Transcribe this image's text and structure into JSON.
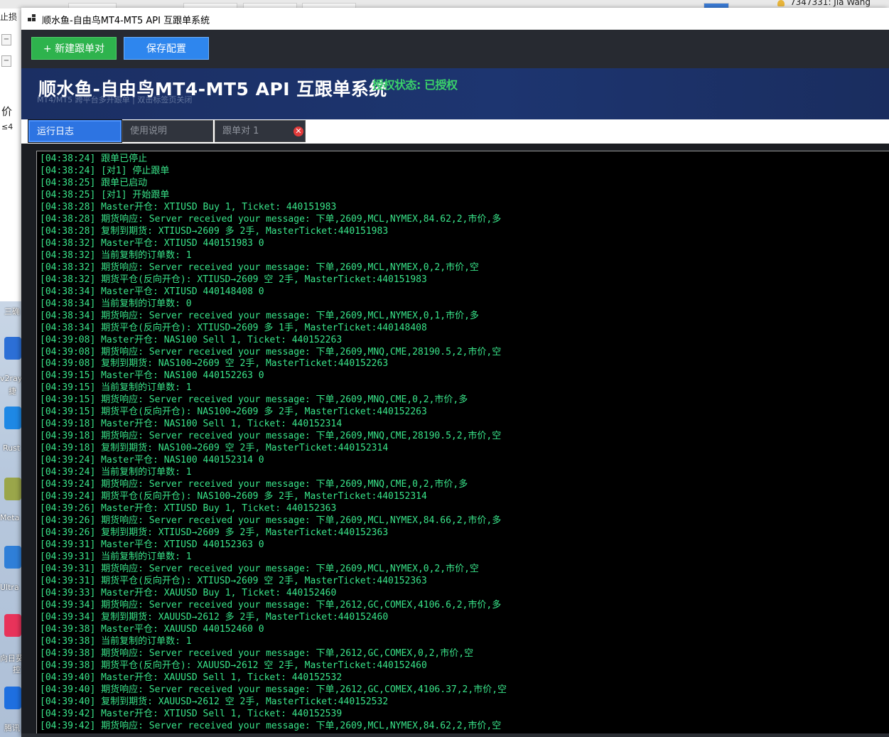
{
  "background": {
    "fragments": [
      "止损",
      "价",
      "≤4",
      "三确",
      "v2ray",
      "捷",
      "Rust",
      "Meta",
      "Ultra",
      "向日葵",
      "控",
      "腾讯"
    ],
    "user_label": "7347331: Jia Wang"
  },
  "window": {
    "title": "顺水鱼-自由鸟MT4-MT5 API 互跟单系统",
    "icon": "app-grid-icon"
  },
  "toolbar": {
    "new_pair_label": "+ 新建跟单对",
    "save_label": "保存配置",
    "new_color": "#2eb34d",
    "save_color": "#2e86ee"
  },
  "banner": {
    "title": "顺水鱼-自由鸟MT4-MT5 API 互跟单系统",
    "subtitle": "MT4/MT5 跨平台多开跟单 | 双击标签页关闭",
    "license_status": "授权状态: 已授权",
    "status_color": "#3ad06a"
  },
  "tabs": [
    {
      "label": "运行日志",
      "active": true
    },
    {
      "label": "使用说明",
      "active": false
    },
    {
      "label": "跟单对 1",
      "active": false,
      "closable": true
    }
  ],
  "log": {
    "text_color": "#39e58a",
    "lines": [
      "[04:38:24] 跟单已停止",
      "[04:38:24] [对1] 停止跟单",
      "[04:38:25] 跟单已启动",
      "[04:38:25] [对1] 开始跟单",
      "[04:38:28] Master开仓: XTIUSD Buy 1, Ticket: 440151983",
      "[04:38:28] 期货响应: Server received your message: 下单,2609,MCL,NYMEX,84.62,2,市价,多",
      "[04:38:28] 复制到期货: XTIUSD→2609 多 2手, MasterTicket:440151983",
      "[04:38:32] Master平仓: XTIUSD 440151983 0",
      "[04:38:32] 当前复制的订单数: 1",
      "[04:38:32] 期货响应: Server received your message: 下单,2609,MCL,NYMEX,0,2,市价,空",
      "[04:38:32] 期货平仓(反向开仓): XTIUSD→2609 空 2手, MasterTicket:440151983",
      "[04:38:34] Master平仓: XTIUSD 440148408 0",
      "[04:38:34] 当前复制的订单数: 0",
      "[04:38:34] 期货响应: Server received your message: 下单,2609,MCL,NYMEX,0,1,市价,多",
      "[04:38:34] 期货平仓(反向开仓): XTIUSD→2609 多 1手, MasterTicket:440148408",
      "[04:39:08] Master开仓: NAS100 Sell 1, Ticket: 440152263",
      "[04:39:08] 期货响应: Server received your message: 下单,2609,MNQ,CME,28190.5,2,市价,空",
      "[04:39:08] 复制到期货: NAS100→2609 空 2手, MasterTicket:440152263",
      "[04:39:15] Master平仓: NAS100 440152263 0",
      "[04:39:15] 当前复制的订单数: 1",
      "[04:39:15] 期货响应: Server received your message: 下单,2609,MNQ,CME,0,2,市价,多",
      "[04:39:15] 期货平仓(反向开仓): NAS100→2609 多 2手, MasterTicket:440152263",
      "[04:39:18] Master开仓: NAS100 Sell 1, Ticket: 440152314",
      "[04:39:18] 期货响应: Server received your message: 下单,2609,MNQ,CME,28190.5,2,市价,空",
      "[04:39:18] 复制到期货: NAS100→2609 空 2手, MasterTicket:440152314",
      "[04:39:24] Master平仓: NAS100 440152314 0",
      "[04:39:24] 当前复制的订单数: 1",
      "[04:39:24] 期货响应: Server received your message: 下单,2609,MNQ,CME,0,2,市价,多",
      "[04:39:24] 期货平仓(反向开仓): NAS100→2609 多 2手, MasterTicket:440152314",
      "[04:39:26] Master开仓: XTIUSD Buy 1, Ticket: 440152363",
      "[04:39:26] 期货响应: Server received your message: 下单,2609,MCL,NYMEX,84.66,2,市价,多",
      "[04:39:26] 复制到期货: XTIUSD→2609 多 2手, MasterTicket:440152363",
      "[04:39:31] Master平仓: XTIUSD 440152363 0",
      "[04:39:31] 当前复制的订单数: 1",
      "[04:39:31] 期货响应: Server received your message: 下单,2609,MCL,NYMEX,0,2,市价,空",
      "[04:39:31] 期货平仓(反向开仓): XTIUSD→2609 空 2手, MasterTicket:440152363",
      "[04:39:33] Master开仓: XAUUSD Buy 1, Ticket: 440152460",
      "[04:39:34] 期货响应: Server received your message: 下单,2612,GC,COMEX,4106.6,2,市价,多",
      "[04:39:34] 复制到期货: XAUUSD→2612 多 2手, MasterTicket:440152460",
      "[04:39:38] Master平仓: XAUUSD 440152460 0",
      "[04:39:38] 当前复制的订单数: 1",
      "[04:39:38] 期货响应: Server received your message: 下单,2612,GC,COMEX,0,2,市价,空",
      "[04:39:38] 期货平仓(反向开仓): XAUUSD→2612 空 2手, MasterTicket:440152460",
      "[04:39:40] Master开仓: XAUUSD Sell 1, Ticket: 440152532",
      "[04:39:40] 期货响应: Server received your message: 下单,2612,GC,COMEX,4106.37,2,市价,空",
      "[04:39:40] 复制到期货: XAUUSD→2612 空 2手, MasterTicket:440152532",
      "[04:39:42] Master开仓: XTIUSD Sell 1, Ticket: 440152539",
      "[04:39:42] 期货响应: Server received your message: 下单,2609,MCL,NYMEX,84.62,2,市价,空"
    ]
  }
}
